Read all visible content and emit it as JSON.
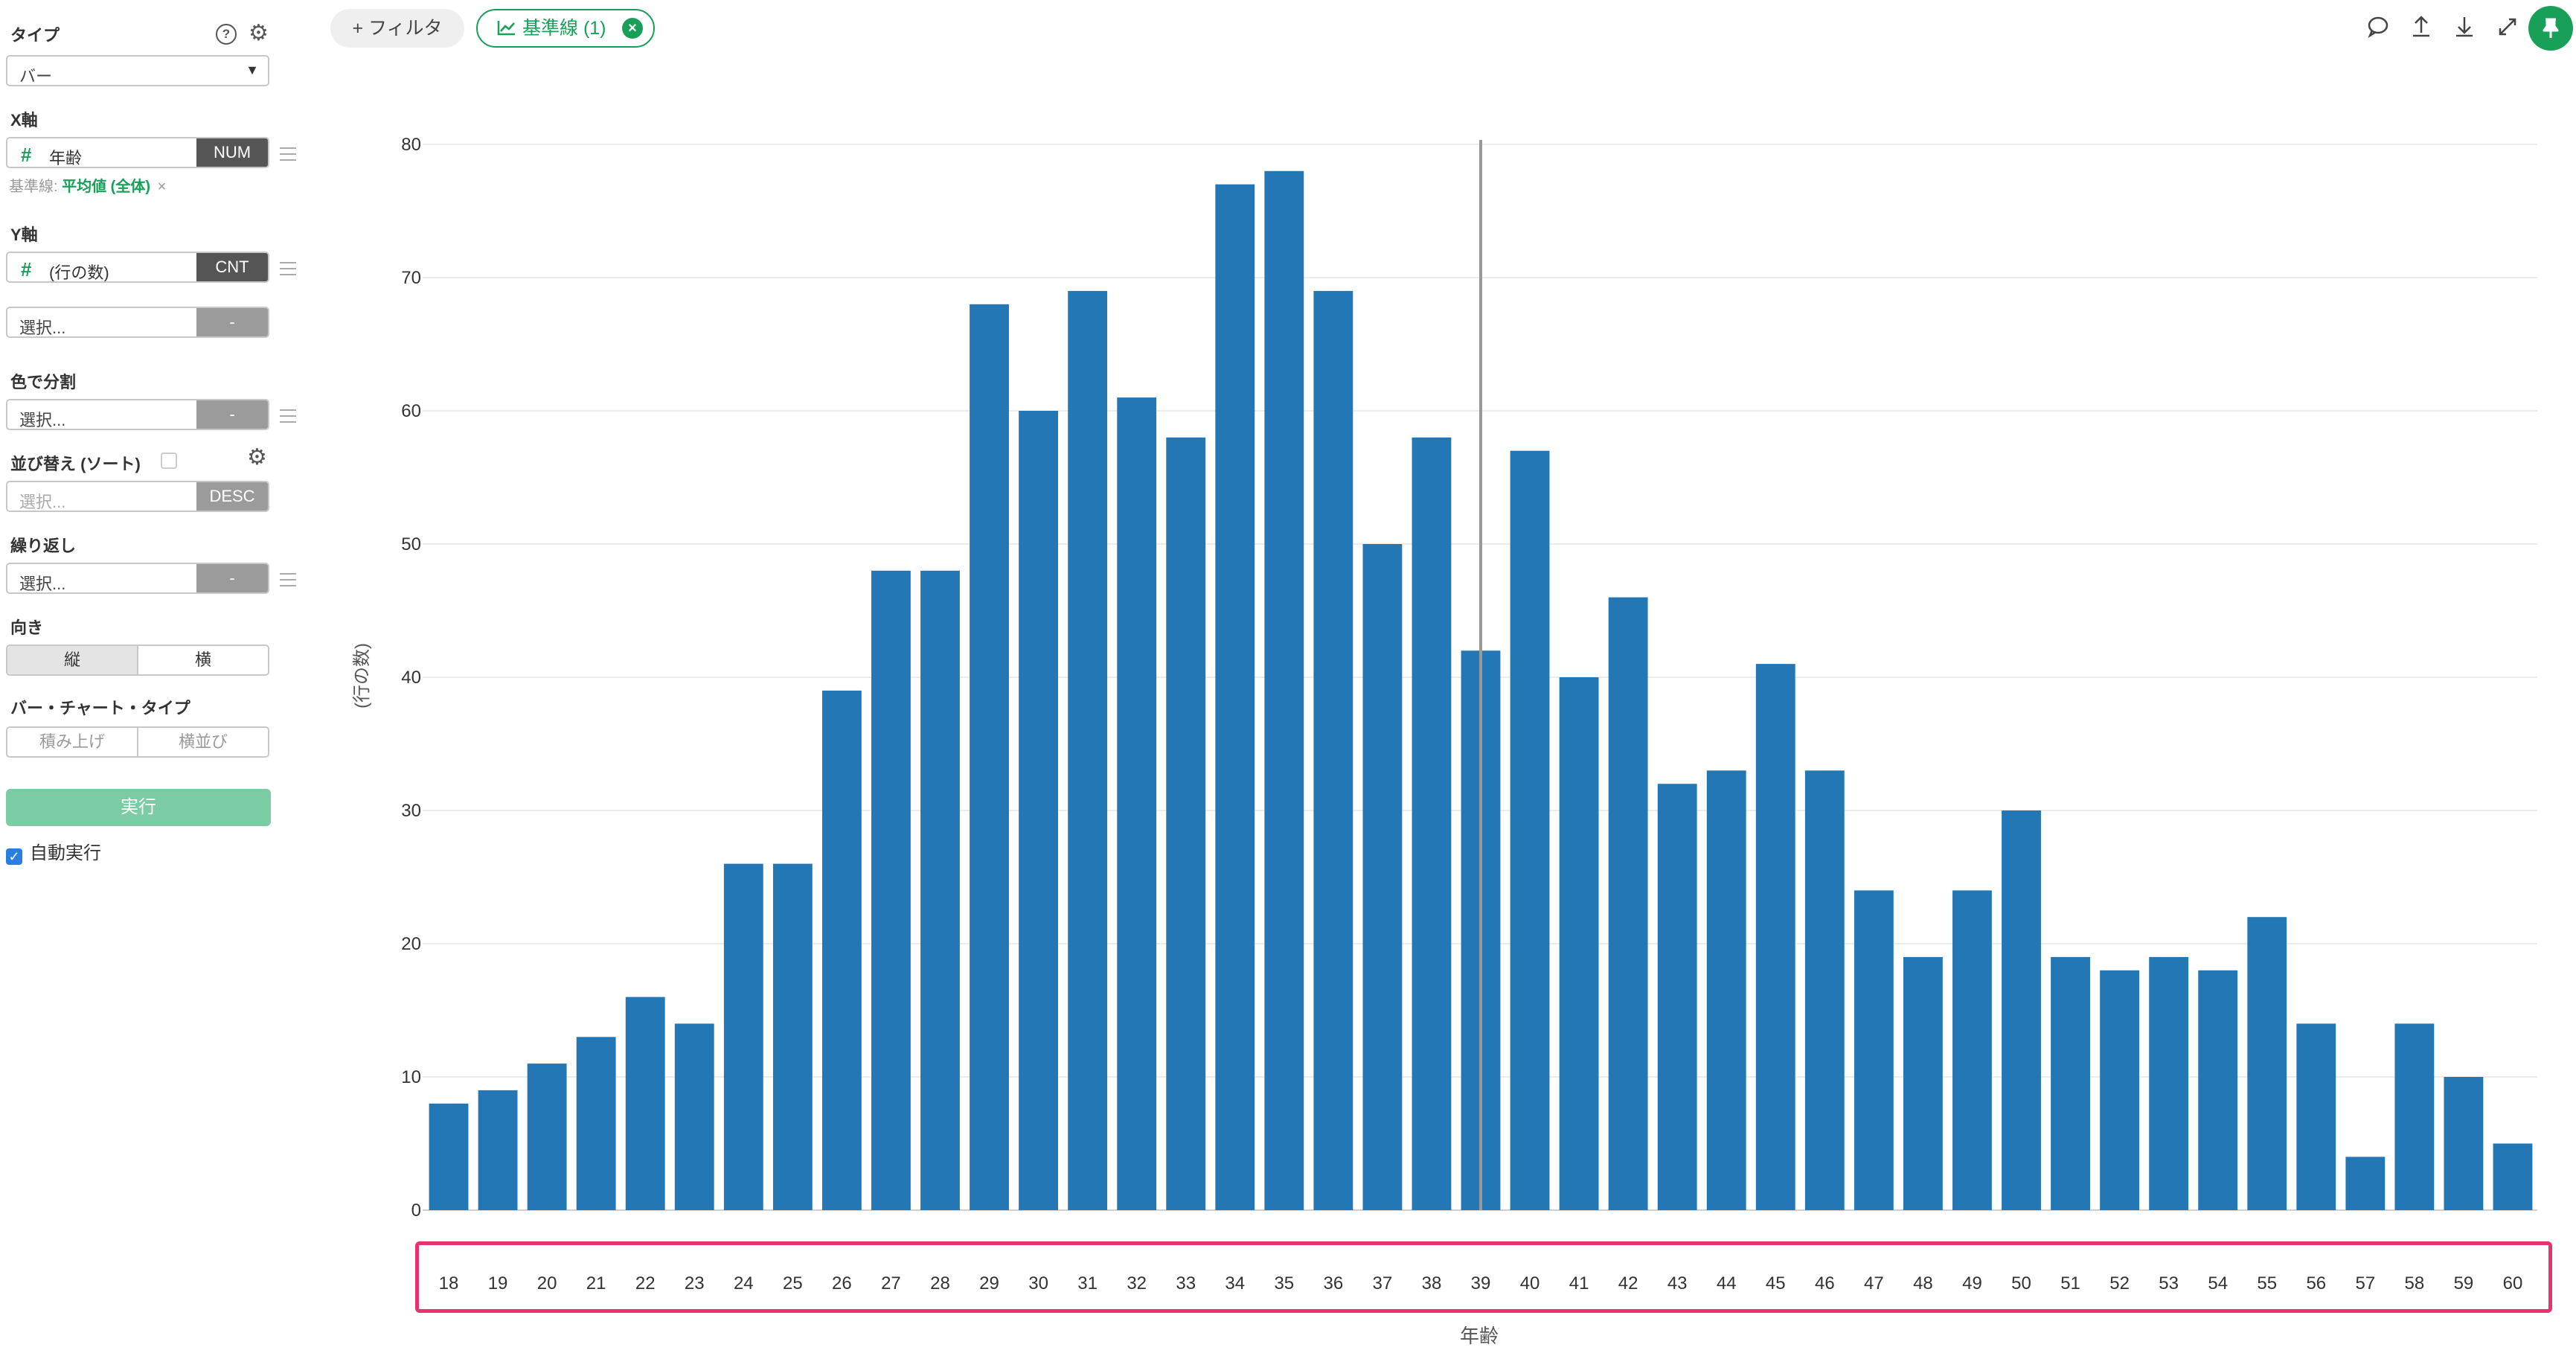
{
  "sidebar": {
    "type_label": "タイプ",
    "type_value": "バー",
    "x_axis_label": "X軸",
    "x_field": "年齢",
    "x_tag": "NUM",
    "baseline_prefix": "基準線:",
    "baseline_value": "平均値 (全体)",
    "baseline_remove": "×",
    "y_axis_label": "Y軸",
    "y_field": "(行の数)",
    "y_tag": "CNT",
    "y2_placeholder": "選択...",
    "y2_tag": "-",
    "color_label": "色で分割",
    "color_placeholder": "選択...",
    "color_tag": "-",
    "sort_label": "並び替え (ソート)",
    "sort_placeholder": "選択...",
    "sort_tag": "DESC",
    "repeat_label": "繰り返し",
    "repeat_placeholder": "選択...",
    "repeat_tag": "-",
    "orientation_label": "向き",
    "orientation_options": [
      "縦",
      "横"
    ],
    "bar_type_label": "バー・チャート・タイプ",
    "bar_type_options": [
      "積み上げ",
      "横並び"
    ],
    "run_label": "実行",
    "auto_run_label": "自動実行"
  },
  "toolbar": {
    "filter_label": "+ フィルタ",
    "baseline_chip_label": "基準線 (1)"
  },
  "colors": {
    "bar": "#2477b5",
    "accent": "#18a058",
    "highlight": "#e8326e"
  },
  "chart_data": {
    "type": "bar",
    "xlabel": "年齢",
    "ylabel": "(行の数)",
    "ylim": [
      0,
      80
    ],
    "yticks": [
      0,
      10,
      20,
      30,
      40,
      50,
      60,
      70,
      80
    ],
    "categories": [
      "18",
      "19",
      "20",
      "21",
      "22",
      "23",
      "24",
      "25",
      "26",
      "27",
      "28",
      "29",
      "30",
      "31",
      "32",
      "33",
      "34",
      "35",
      "36",
      "37",
      "38",
      "39",
      "40",
      "41",
      "42",
      "43",
      "44",
      "45",
      "46",
      "47",
      "48",
      "49",
      "50",
      "51",
      "52",
      "53",
      "54",
      "55",
      "56",
      "57",
      "58",
      "59",
      "60"
    ],
    "values": [
      8,
      9,
      11,
      13,
      16,
      14,
      26,
      26,
      39,
      48,
      48,
      68,
      60,
      69,
      61,
      58,
      77,
      78,
      69,
      50,
      58,
      42,
      57,
      40,
      46,
      32,
      33,
      41,
      33,
      24,
      19,
      24,
      30,
      19,
      18,
      19,
      18,
      22,
      14,
      4,
      14,
      10,
      5
    ],
    "baseline": {
      "x": 39
    }
  }
}
